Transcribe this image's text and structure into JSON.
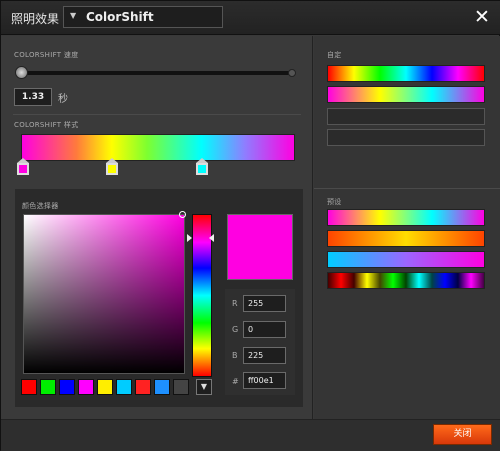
{
  "titlebar": {
    "label": "照明效果",
    "effect_select": "ColorShift",
    "close_icon": "close-icon"
  },
  "speed": {
    "label": "COLORSHIFT 速度",
    "value": "1.33",
    "unit": "秒",
    "slider_level": 0.0
  },
  "style": {
    "label": "COLORSHIFT 样式",
    "gradient_stop_colors": [
      "#ff00e1",
      "#ffff00",
      "#00ffff"
    ]
  },
  "picker": {
    "label": "颜色选择器",
    "current_color": "#ff00e1",
    "fields": [
      {
        "label": "R",
        "value": "255"
      },
      {
        "label": "G",
        "value": "0"
      },
      {
        "label": "B",
        "value": "225"
      },
      {
        "label": "#",
        "value": "ff00e1"
      }
    ],
    "swatches": [
      "#ff0000",
      "#00ee00",
      "#0000ff",
      "#ff00ff",
      "#ffee00",
      "#00ccff",
      "#ff2222",
      "#1e90ff",
      "#444444"
    ],
    "more_icon": "triangle-down-icon"
  },
  "custom": {
    "label": "自定"
  },
  "presets": {
    "label": "预设"
  },
  "footer": {
    "close_label": "关闭"
  }
}
